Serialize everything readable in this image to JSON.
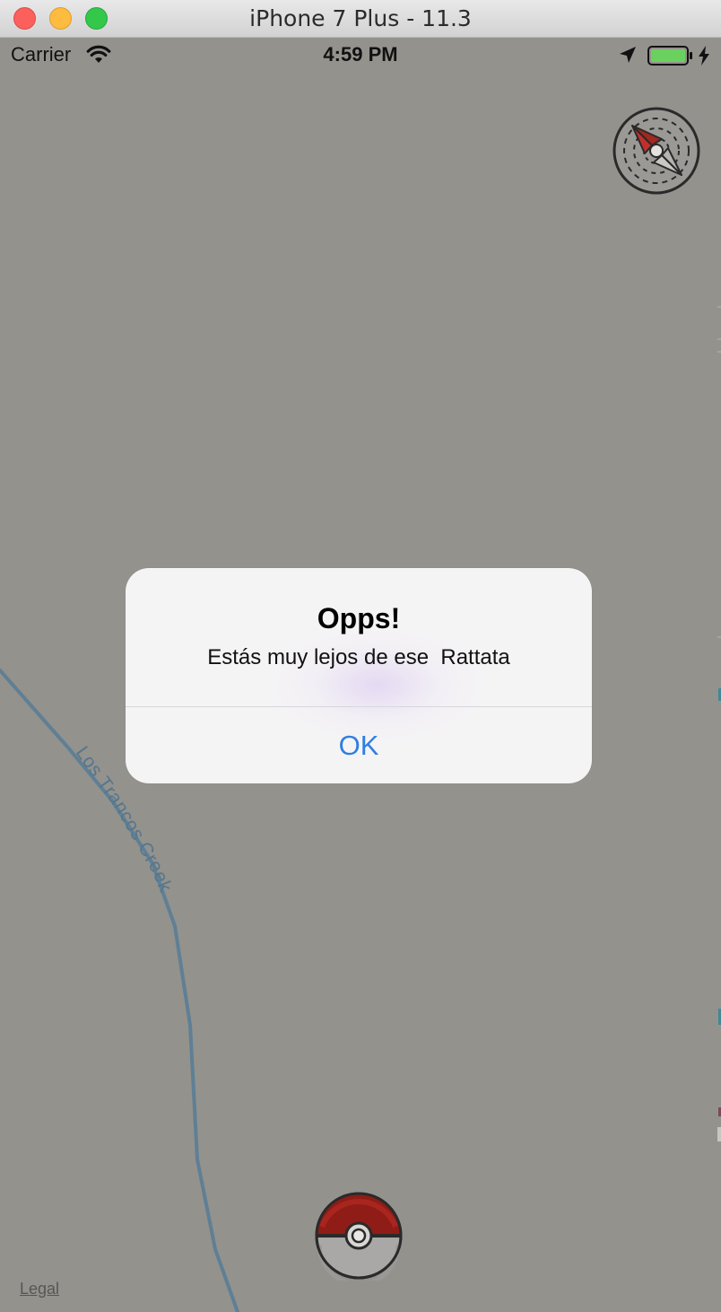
{
  "window": {
    "title": "iPhone 7 Plus - 11.3"
  },
  "status_bar": {
    "carrier": "Carrier",
    "time": "4:59 PM",
    "battery_color": "#6ad15e"
  },
  "map": {
    "background_color": "#93928d",
    "creek_label": "Los Trancos Creek",
    "creek_color": "#5f7f95",
    "legal_label": "Legal"
  },
  "alert": {
    "title": "Opps!",
    "message": "Estás muy lejos de ese  Rattata",
    "ok_label": "OK",
    "button_color": "#2f7fe0"
  },
  "icons": {
    "compass": "compass-icon",
    "pokeball": "pokeball-icon",
    "wifi": "wifi-icon",
    "location": "location-arrow-icon",
    "battery": "battery-icon",
    "charging": "charging-bolt-icon"
  }
}
